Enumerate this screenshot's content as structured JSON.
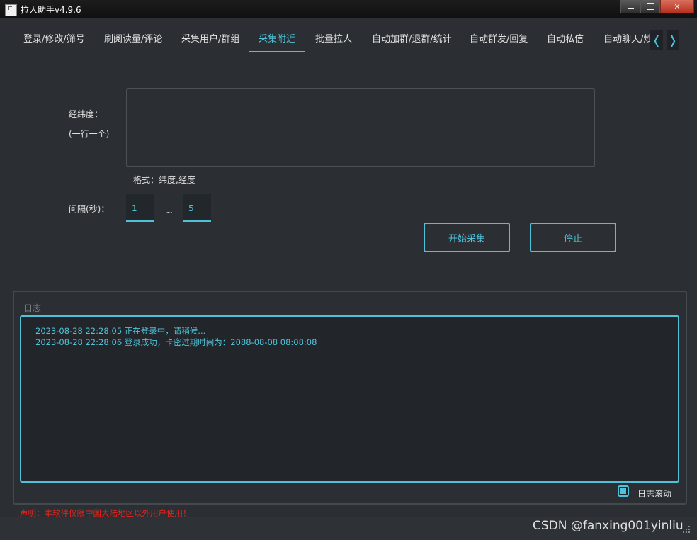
{
  "window": {
    "title": "拉人助手v4.9.6"
  },
  "tabs": [
    {
      "label": "登录/修改/筛号"
    },
    {
      "label": "刷阅读量/评论"
    },
    {
      "label": "采集用户/群组"
    },
    {
      "label": "采集附近"
    },
    {
      "label": "批量拉人"
    },
    {
      "label": "自动加群/退群/统计"
    },
    {
      "label": "自动群发/回复"
    },
    {
      "label": "自动私信"
    },
    {
      "label": "自动聊天/炒"
    }
  ],
  "active_tab": "采集附近",
  "tab_scroll": {
    "left": "❬",
    "right": "❭"
  },
  "form": {
    "coords_label": "经纬度：",
    "coords_hint": "(一行一个)",
    "coords_value": "",
    "format_label": "格式：纬度,经度",
    "interval_label": "间隔(秒)：",
    "interval_min": "1",
    "interval_sep": "~",
    "interval_max": "5"
  },
  "buttons": {
    "start": "开始采集",
    "stop": "停止"
  },
  "log": {
    "title": "日志",
    "lines": [
      "2023-08-28 22:28:05 正在登录中，请稍候...",
      "2023-08-28 22:28:06 登录成功，卡密过期时间为：2088-08-08 08:08:08"
    ],
    "autoscroll_label": "日志滚动",
    "autoscroll_checked": true
  },
  "notice": "声明：本软件仅限中国大陆地区以外用户使用！",
  "watermark": "CSDN @fanxing001yinliu",
  "colors": {
    "accent": "#4fc1d9",
    "warning": "#e8231d",
    "background": "#2b2f33"
  }
}
